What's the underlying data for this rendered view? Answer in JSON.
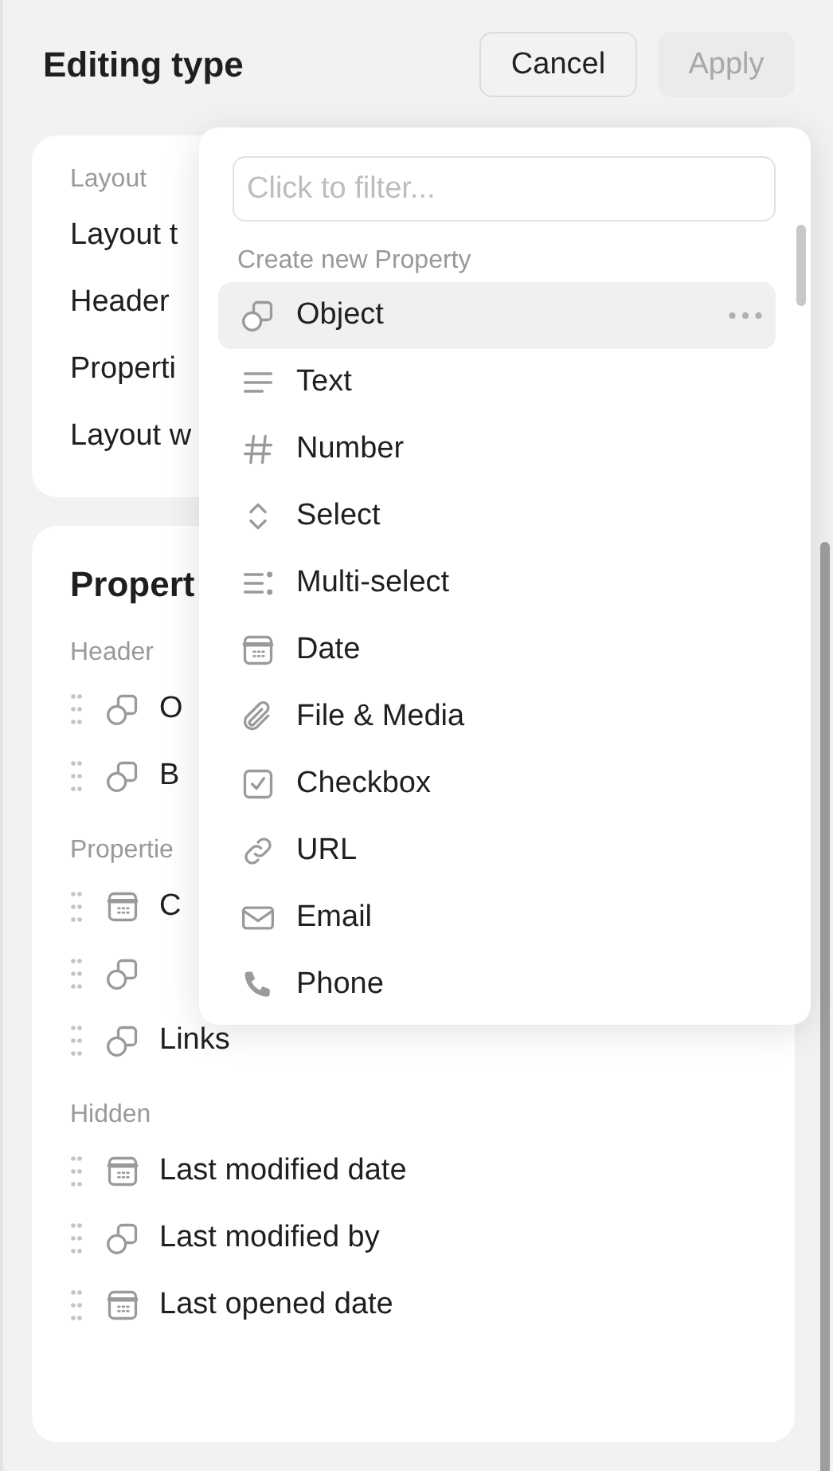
{
  "header": {
    "title": "Editing type",
    "buttons": [
      {
        "label": "Cancel",
        "disabled": false
      },
      {
        "label": "Apply",
        "disabled": true
      }
    ]
  },
  "layout_card": {
    "section": "Layout",
    "rows": [
      "Layout t",
      "Header",
      "Properti",
      "Layout w"
    ]
  },
  "properties_card": {
    "title": "Propert",
    "sections": [
      {
        "label": "Header",
        "rows": [
          {
            "kind": "object",
            "label": "O"
          },
          {
            "kind": "object",
            "label": "B"
          }
        ]
      },
      {
        "label": "Propertie",
        "rows": [
          {
            "kind": "date",
            "label": "C"
          },
          {
            "kind": "object"
          },
          {
            "kind": "object",
            "label": "Links"
          }
        ]
      },
      {
        "label": "Hidden",
        "rows": [
          {
            "kind": "date",
            "label": "Last modified date"
          },
          {
            "kind": "object",
            "label": "Last modified by"
          },
          {
            "kind": "date",
            "label": "Last opened date"
          }
        ]
      }
    ]
  },
  "property_menu": {
    "filter": {
      "placeholder": "Click to filter..."
    },
    "heading": "Create new Property",
    "items": [
      {
        "kind": "object",
        "label": "Object",
        "selected": true
      },
      {
        "kind": "text",
        "label": "Text",
        "selected": false
      },
      {
        "kind": "number",
        "label": "Number",
        "selected": false
      },
      {
        "kind": "select",
        "label": "Select",
        "selected": false
      },
      {
        "kind": "multi-select",
        "label": "Multi-select",
        "selected": false
      },
      {
        "kind": "date",
        "label": "Date",
        "selected": false
      },
      {
        "kind": "file",
        "label": "File & Media",
        "selected": false
      },
      {
        "kind": "checkbox",
        "label": "Checkbox",
        "selected": false
      },
      {
        "kind": "url",
        "label": "URL",
        "selected": false
      },
      {
        "kind": "email",
        "label": "Email",
        "selected": false
      },
      {
        "kind": "phone",
        "label": "Phone",
        "selected": false
      }
    ]
  }
}
